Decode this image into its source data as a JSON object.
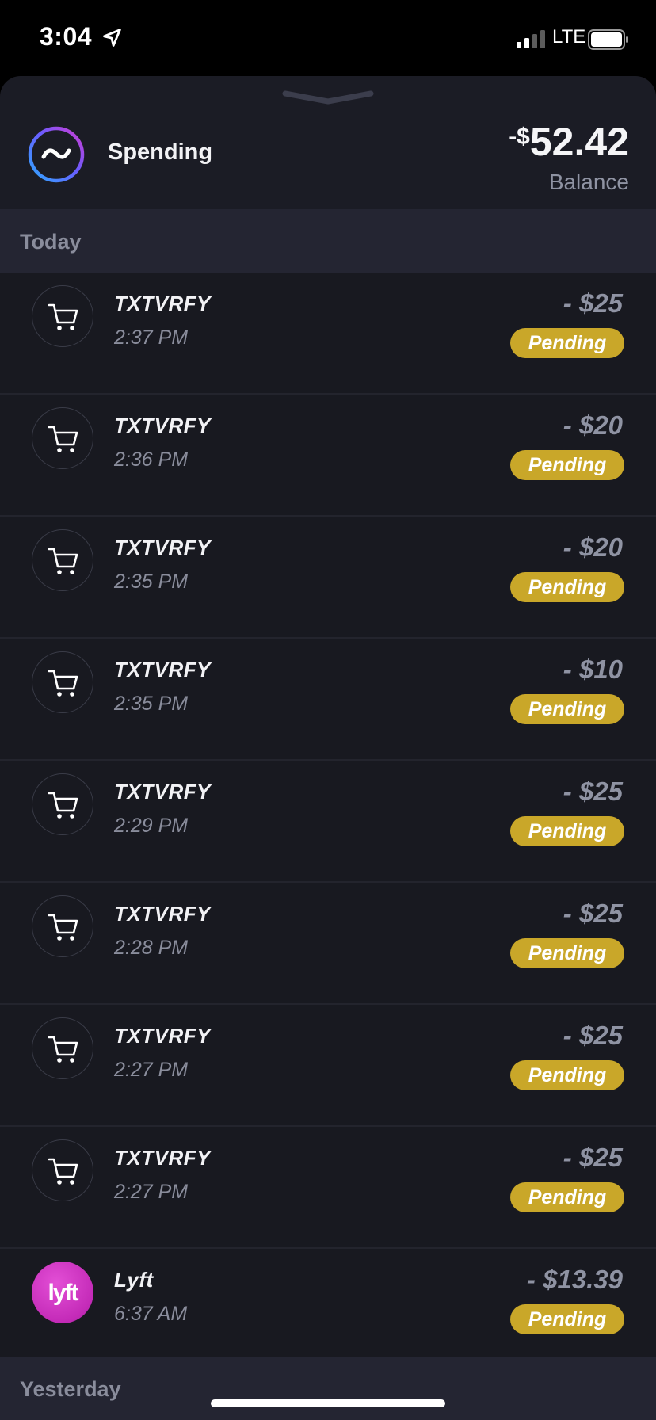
{
  "status_bar": {
    "time": "3:04",
    "network": "LTE",
    "icons": [
      "location-arrow-icon",
      "signal-icon",
      "battery-icon"
    ]
  },
  "account": {
    "name": "Spending",
    "balance_prefix": "-$",
    "balance_value": "52.42",
    "balance_label": "Balance",
    "logo_icon": "wave-logo-icon"
  },
  "sections": {
    "today": "Today",
    "yesterday": "Yesterday"
  },
  "transactions": [
    {
      "merchant": "TXTVRFY",
      "time": "2:37 PM",
      "amount": "- $25",
      "status": "Pending",
      "icon": "cart-icon"
    },
    {
      "merchant": "TXTVRFY",
      "time": "2:36 PM",
      "amount": "- $20",
      "status": "Pending",
      "icon": "cart-icon"
    },
    {
      "merchant": "TXTVRFY",
      "time": "2:35 PM",
      "amount": "- $20",
      "status": "Pending",
      "icon": "cart-icon"
    },
    {
      "merchant": "TXTVRFY",
      "time": "2:35 PM",
      "amount": "- $10",
      "status": "Pending",
      "icon": "cart-icon"
    },
    {
      "merchant": "TXTVRFY",
      "time": "2:29 PM",
      "amount": "- $25",
      "status": "Pending",
      "icon": "cart-icon"
    },
    {
      "merchant": "TXTVRFY",
      "time": "2:28 PM",
      "amount": "- $25",
      "status": "Pending",
      "icon": "cart-icon"
    },
    {
      "merchant": "TXTVRFY",
      "time": "2:27 PM",
      "amount": "- $25",
      "status": "Pending",
      "icon": "cart-icon"
    },
    {
      "merchant": "TXTVRFY",
      "time": "2:27 PM",
      "amount": "- $25",
      "status": "Pending",
      "icon": "cart-icon"
    },
    {
      "merchant": "Lyft",
      "time": "6:37 AM",
      "amount": "- $13.39",
      "status": "Pending",
      "icon": "lyft-logo-icon"
    }
  ],
  "colors": {
    "sheet_background": "#1b1c25",
    "row_background": "#181920",
    "section_background": "#242532",
    "pending_badge": "#c9a729",
    "lyft_brand": "#c42bb8"
  }
}
